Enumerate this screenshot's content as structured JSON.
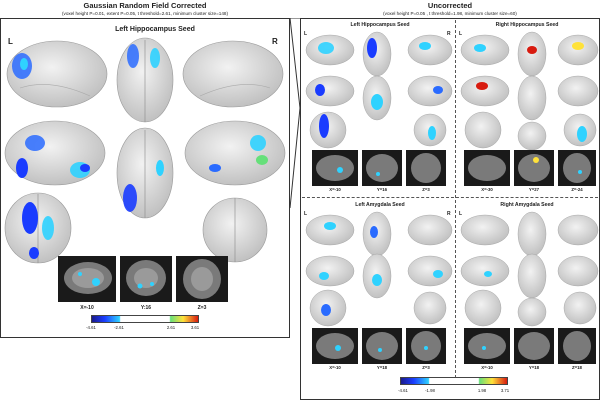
{
  "left_header": {
    "title": "Gaussian Random Field Corrected",
    "subtitle": "(voxel height P=0.01, extent P=0.05, t threshold=2.61, minimum cluster size=148)"
  },
  "right_header": {
    "title": "Uncorrected",
    "subtitle": "(voxel height P=0.05 , t threshold=1.98, minimum cluster size=60)"
  },
  "left_panel": {
    "seed_title": "Left Hippocampus Seed",
    "left_label": "L",
    "right_label": "R",
    "coords": [
      "X=-10",
      "Y:16",
      "Z=3"
    ],
    "colorbar_ticks": [
      "-4.61",
      "-2.61",
      "2.61",
      "3.61"
    ]
  },
  "right_panel": {
    "quadrants": [
      {
        "seed_title": "Left Hippocampus Seed",
        "left_label": "L",
        "right_label": "R",
        "coords": [
          "X=-10",
          "Y=16",
          "Z=3"
        ]
      },
      {
        "seed_title": "Right Hippocampus Seed",
        "left_label": "L",
        "right_label": "",
        "coords": [
          "X=-30",
          "Y=27",
          "Z=-24"
        ]
      },
      {
        "seed_title": "Left Amygdala Seed",
        "left_label": "L",
        "right_label": "R",
        "coords": [
          "X=-10",
          "Y=18",
          "Z=3"
        ]
      },
      {
        "seed_title": "Right Amygdala Seed",
        "left_label": "L",
        "right_label": "",
        "coords": [
          "X=-10",
          "Y=18",
          "Z=18"
        ]
      }
    ],
    "colorbar_ticks": [
      "-4.61",
      "-1.98",
      "1.98",
      "3.71"
    ]
  },
  "colors": {
    "brain": "#d9d9d9",
    "brain_edge": "#9a9a9a",
    "neg_strong": "#1a3cff",
    "neg_light": "#2fd2ff",
    "pos_light": "#ffe23a",
    "pos_strong": "#d81b0f"
  }
}
